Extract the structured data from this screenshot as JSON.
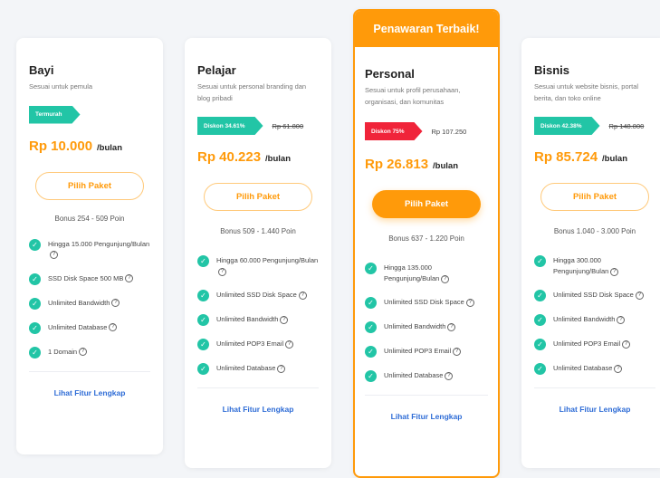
{
  "colors": {
    "accent": "#ff9a0a",
    "teal": "#22c5a6",
    "red": "#f0243a",
    "link": "#2e6cd6"
  },
  "icons": {
    "feature": "check-circle-icon",
    "info": "info-circle-icon"
  },
  "plans": [
    {
      "name": "Bayi",
      "desc": "Sesuai untuk pemula",
      "badge": "Termurah",
      "price": "Rp 10.000",
      "per": "/bulan",
      "button": "Pilih Paket",
      "bonus": "Bonus 254 - 509 Poin",
      "features": [
        {
          "text": "Hingga 15.000 Pengunjung/Bulan",
          "info": true
        },
        {
          "text": "SSD Disk Space 500 MB",
          "info": true
        },
        {
          "text": "Unlimited Bandwidth",
          "info": true
        },
        {
          "text": "Unlimited Database",
          "info": true
        },
        {
          "text": "1 Domain",
          "info": true
        }
      ],
      "more": "Lihat Fitur Lengkap"
    },
    {
      "name": "Pelajar",
      "desc": "Sesuai untuk personal branding dan blog pribadi",
      "badge": "Diskon 34.61%",
      "old_price": "Rp 61.800",
      "price": "Rp 40.223",
      "per": "/bulan",
      "button": "Pilih Paket",
      "bonus": "Bonus 509 - 1.440 Poin",
      "features": [
        {
          "text": "Hingga 60.000 Pengunjung/Bulan",
          "info": true
        },
        {
          "text": "Unlimited SSD Disk Space",
          "info": true
        },
        {
          "text": "Unlimited Bandwidth",
          "info": true
        },
        {
          "text": "Unlimited POP3 Email",
          "info": true
        },
        {
          "text": "Unlimited Database",
          "info": true
        }
      ],
      "more": "Lihat Fitur Lengkap"
    },
    {
      "ribbon": "Penawaran Terbaik!",
      "name": "Personal",
      "desc": "Sesuai untuk profil perusahaan, organisasi, dan komunitas",
      "badge": "Diskon 75%",
      "old_price": "Rp 107.250",
      "price": "Rp 26.813",
      "per": "/bulan",
      "button": "Pilih Paket",
      "bonus": "Bonus 637 - 1.220 Poin",
      "features": [
        {
          "text": "Hingga 135.000 Pengunjung/Bulan",
          "info": true
        },
        {
          "text": "Unlimited SSD Disk Space",
          "info": true
        },
        {
          "text": "Unlimited Bandwidth",
          "info": true
        },
        {
          "text": "Unlimited POP3 Email",
          "info": true
        },
        {
          "text": "Unlimited Database",
          "info": true
        }
      ],
      "more": "Lihat Fitur Lengkap"
    },
    {
      "name": "Bisnis",
      "desc": "Sesuai untuk website bisnis, portal berita, dan toko online",
      "badge": "Diskon 42.38%",
      "old_price": "Rp 148.800",
      "price": "Rp 85.724",
      "per": "/bulan",
      "button": "Pilih Paket",
      "bonus": "Bonus 1.040 - 3.000 Poin",
      "features": [
        {
          "text": "Hingga 300.000 Pengunjung/Bulan",
          "info": true
        },
        {
          "text": "Unlimited SSD Disk Space",
          "info": true
        },
        {
          "text": "Unlimited Bandwidth",
          "info": true
        },
        {
          "text": "Unlimited POP3 Email",
          "info": true
        },
        {
          "text": "Unlimited Database",
          "info": true
        }
      ],
      "more": "Lihat Fitur Lengkap"
    }
  ]
}
